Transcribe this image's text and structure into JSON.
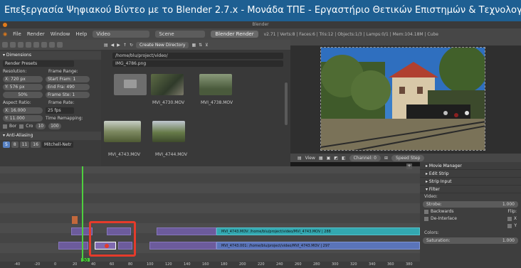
{
  "banner": {
    "title": "Επεξεργασία Ψηφιακού Βίντεο με το Blender 2.7.x - Μονάδα ΤΠΕ - Εργαστήριο Θετικών Επιστημών & Τεχνολογίας - ΠΤΠΕ - Πανεπιστήμιο Θεσσαλίας"
  },
  "window": {
    "title": "Blender"
  },
  "menubar": {
    "items": [
      "File",
      "Render",
      "Window",
      "Help"
    ],
    "screen": "Video",
    "scene": "Scene",
    "engine": "Blender Render",
    "stats": "v2.71 | Verts:8 | Faces:6 | Tris:12 | Objects:1/3 | Lamps:0/1 | Mem:104.18M | Cube"
  },
  "props": {
    "dimensions": "Dimensions",
    "render_presets": "Render Presets",
    "resolution_label": "Resolution:",
    "res_x": "X: 720 px",
    "res_y": "Y: 576 px",
    "res_pct": "50%",
    "frame_range_label": "Frame Range:",
    "start_frame": "Start Fram: 1",
    "end_frame": "End Fra: 490",
    "frame_step": "Frame Ste: 1",
    "aspect_label": "Aspect Ratio:",
    "aspect_x": "X: 16.000",
    "aspect_y": "Y: 11.000",
    "frame_rate_label": "Frame Rate:",
    "fps": "25 fps",
    "time_remap_label": "Time Remapping:",
    "remap_old": "10",
    "remap_new": "100",
    "border": "Bor",
    "crop": "Cro",
    "antialias": "Anti-Aliasing",
    "aa_samples": [
      "5",
      "8",
      "11",
      "16"
    ],
    "filter": "Mitchell-Netr"
  },
  "files": {
    "new_directory": "Create New Directory",
    "path": "/home/blu/project/video/",
    "filename": "IMG_4786.png",
    "thumbnails": [
      {
        "label": "",
        "type": "folder"
      },
      {
        "label": "MVI_4730.MOV",
        "type": "video"
      },
      {
        "label": "MVI_4738.MOV",
        "type": "video"
      },
      {
        "label": "MVI_4743.MOV",
        "type": "video"
      },
      {
        "label": "MVI_4744.MOV",
        "type": "video"
      }
    ]
  },
  "preview_toolbar": {
    "view": "View",
    "channel": "Channel: 0",
    "speed": "Speed Step"
  },
  "sequencer": {
    "strips": [
      {
        "label": "MVI_4743.MOV: /home/blu/project/video/MVI_4743.MOV | 288",
        "color": "cyan"
      },
      {
        "label": "MVI_4743.001: /home/blu/project/video/MVI_4743.MOV | 297",
        "color": "blue"
      }
    ],
    "current_frame": "30",
    "ruler_ticks": [
      "-40",
      "-20",
      "0",
      "20",
      "40",
      "60",
      "80",
      "100",
      "120",
      "140",
      "160",
      "180",
      "200",
      "220",
      "240",
      "260",
      "280",
      "300",
      "320",
      "340",
      "360",
      "380"
    ]
  },
  "side_panel": {
    "movie_manager": "Movie Manager",
    "edit_strip": "Edit Strip",
    "strip_input": "Strip Input",
    "filter": "Filter",
    "video_label": "Video:",
    "strobe_label": "Strobe:",
    "strobe_value": "1.000",
    "backwards": "Backwards",
    "deinterlace": "De-Interlace",
    "flip_label": "Flip:",
    "flip_x": "X",
    "flip_y": "Y",
    "colors_label": "Colors:",
    "saturation_label": "Saturation:",
    "saturation_value": "1.000"
  },
  "colors": {
    "accent": "#5680c2",
    "highlight": "#e53b2b",
    "playhead": "#4ecf3e",
    "banner": "#1e5f92"
  }
}
